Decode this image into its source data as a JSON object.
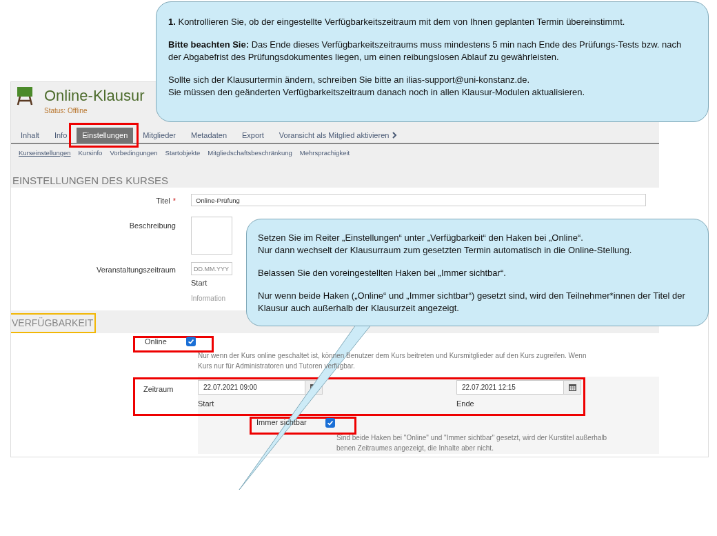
{
  "course": {
    "title": "Online-Klausur",
    "status": "Status: Offline"
  },
  "tabs": [
    {
      "label": "Inhalt",
      "selected": false,
      "kind": "tab"
    },
    {
      "label": "Info",
      "selected": false,
      "kind": "tab"
    },
    {
      "label": "Einstellungen",
      "selected": true,
      "kind": "tab"
    },
    {
      "label": "Mitglieder",
      "selected": false,
      "kind": "tab"
    },
    {
      "label": "Metadaten",
      "selected": false,
      "kind": "tab"
    },
    {
      "label": "Export",
      "selected": false,
      "kind": "tab"
    },
    {
      "label": "Voransicht als Mitglied aktivieren",
      "selected": false,
      "kind": "action"
    }
  ],
  "subtabs": [
    {
      "label": "Kurseinstellungen",
      "selected": true
    },
    {
      "label": "Kursinfo",
      "selected": false
    },
    {
      "label": "Vorbedingungen",
      "selected": false
    },
    {
      "label": "Startobjekte",
      "selected": false
    },
    {
      "label": "Mitgliedschaftsbeschränkung",
      "selected": false
    },
    {
      "label": "Mehrsprachigkeit",
      "selected": false
    }
  ],
  "settings": {
    "heading": "EINSTELLUNGEN DES KURSES",
    "title_field": {
      "label": "Titel",
      "required_mark": "*",
      "value": "Online-Prüfung"
    },
    "description_field": {
      "label": "Beschreibung"
    },
    "period_field": {
      "label": "Veranstaltungszeitraum",
      "placeholder": "DD.MM.YYY",
      "caption": "Start",
      "info": "Information"
    }
  },
  "availability": {
    "heading": "VERFÜGBARKEIT",
    "online": {
      "label": "Online",
      "checked": true,
      "description": "Nur wenn der Kurs online geschaltet ist, können Benutzer dem Kurs beitreten und Kursmitglieder auf den Kurs zugreifen. Wenn",
      "description_2": "Kurs nur für Administratoren und Tutoren verfügbar."
    },
    "period": {
      "label": "Zeitraum",
      "start": {
        "value": "22.07.2021 09:00",
        "caption": "Start"
      },
      "end": {
        "value": "22.07.2021 12:15",
        "caption": "Ende"
      }
    },
    "always_visible": {
      "label": "Immer sichtbar",
      "checked": true,
      "description": "Sind beide Haken bei \"Online\" und \"Immer sichtbar\" gesetzt, wird der Kurstitel außerhalb",
      "description_2": "benen Zeitraumes angezeigt, die Inhalte aber nicht."
    }
  },
  "callouts": [
    {
      "paragraphs": [
        [
          "**1.** Kontrollieren Sie, ob der eingestellte Verfügbarkeitszeitraum mit dem von Ihnen geplanten Termin übereinstimmt."
        ],
        [
          "**Bitte beachten Sie:** Das Ende dieses Verfügbarkeitszeitraums muss mindestens 5 min nach Ende des Prüfungs-Tests bzw. nach der Abgabefrist des Prüfungsdokumentes liegen, um einen reibungslosen Ablauf zu gewährleisten."
        ],
        [
          "Sollte sich der Klausurtermin ändern, schreiben Sie bitte an ilias-support@uni-konstanz.de.",
          "Sie müssen den geänderten Verfügbarkeitszeitraum danach noch in allen Klausur-Modulen aktualisieren."
        ]
      ]
    },
    {
      "paragraphs": [
        [
          "Setzen Sie im Reiter „Einstellungen“ unter „Verfügbarkeit“ den Haken bei „Online“.",
          "Nur dann wechselt der Klausurraum zum gesetzten Termin automatisch in die Online-Stellung."
        ],
        [
          "Belassen Sie den voreingestellten Haken bei „Immer sichtbar“."
        ],
        [
          "Nur wenn beide Haken („Online“ und „Immer sichtbar“) gesetzt sind, wird den Teilnehmer*innen der Titel der Klausur auch außerhalb der Klausurzeit angezeigt."
        ]
      ]
    }
  ]
}
